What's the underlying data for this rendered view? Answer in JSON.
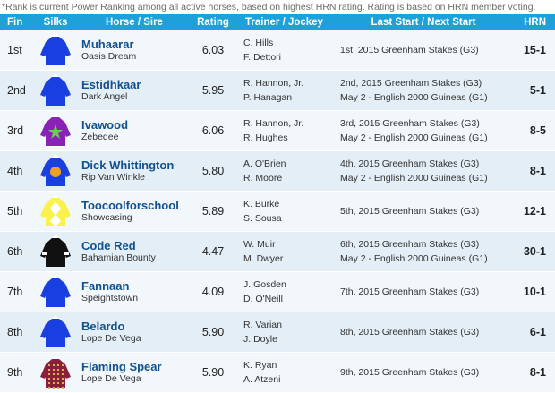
{
  "note": "*Rank is current Power Ranking among all active horses, based on highest HRN rating. Rating is based on HRN member voting.",
  "header": {
    "fin": "Fin",
    "silks": "Silks",
    "horse": "Horse / Sire",
    "rating": "Rating",
    "trainer": "Trainer / Jockey",
    "last": "Last Start / Next Start",
    "hrn": "HRN"
  },
  "rows": [
    {
      "fin": "1st",
      "horse": "Muhaarar",
      "sire": "Oasis Dream",
      "rating": "6.03",
      "trainer": "C. Hills",
      "jockey": "F. Dettori",
      "last": "1st, 2015 Greenham Stakes (G3)",
      "next": "",
      "hrn": "15-1",
      "silk": "royal-blue"
    },
    {
      "fin": "2nd",
      "horse": "Estidhkaar",
      "sire": "Dark Angel",
      "rating": "5.95",
      "trainer": "R. Hannon, Jr.",
      "jockey": "P. Hanagan",
      "last": "2nd, 2015 Greenham Stakes (G3)",
      "next": "May 2 - English 2000 Guineas (G1)",
      "hrn": "5-1",
      "silk": "royal-blue"
    },
    {
      "fin": "3rd",
      "horse": "Ivawood",
      "sire": "Zebedee",
      "rating": "6.06",
      "trainer": "R. Hannon, Jr.",
      "jockey": "R. Hughes",
      "last": "3rd, 2015 Greenham Stakes (G3)",
      "next": "May 2 - English 2000 Guineas (G1)",
      "hrn": "8-5",
      "silk": "purple-green-star"
    },
    {
      "fin": "4th",
      "horse": "Dick Whittington",
      "sire": "Rip Van Winkle",
      "rating": "5.80",
      "trainer": "A. O'Brien",
      "jockey": "R. Moore",
      "last": "4th, 2015 Greenham Stakes (G3)",
      "next": "May 2 - English 2000 Guineas (G1)",
      "hrn": "8-1",
      "silk": "blue-orange-disc"
    },
    {
      "fin": "5th",
      "horse": "Toocoolforschool",
      "sire": "Showcasing",
      "rating": "5.89",
      "trainer": "K. Burke",
      "jockey": "S. Sousa",
      "last": "5th, 2015 Greenham Stakes (G3)",
      "next": "",
      "hrn": "12-1",
      "silk": "yellow-white-diamonds"
    },
    {
      "fin": "6th",
      "horse": "Code Red",
      "sire": "Bahamian Bounty",
      "rating": "4.47",
      "trainer": "W. Muir",
      "jockey": "M. Dwyer",
      "last": "6th, 2015 Greenham Stakes (G3)",
      "next": "May 2 - English 2000 Guineas (G1)",
      "hrn": "30-1",
      "silk": "black-white"
    },
    {
      "fin": "7th",
      "horse": "Fannaan",
      "sire": "Speightstown",
      "rating": "4.09",
      "trainer": "J. Gosden",
      "jockey": "D. O'Neill",
      "last": "7th, 2015 Greenham Stakes (G3)",
      "next": "",
      "hrn": "10-1",
      "silk": "royal-blue"
    },
    {
      "fin": "8th",
      "horse": "Belardo",
      "sire": "Lope De Vega",
      "rating": "5.90",
      "trainer": "R. Varian",
      "jockey": "J. Doyle",
      "last": "8th, 2015 Greenham Stakes (G3)",
      "next": "",
      "hrn": "6-1",
      "silk": "royal-blue"
    },
    {
      "fin": "9th",
      "horse": "Flaming Spear",
      "sire": "Lope De Vega",
      "rating": "5.90",
      "trainer": "K. Ryan",
      "jockey": "A. Atzeni",
      "last": "9th, 2015 Greenham Stakes (G3)",
      "next": "",
      "hrn": "8-1",
      "silk": "maroon-gold-check"
    }
  ],
  "colors": {
    "header_bg": "#1ea0d8",
    "row_light": "#f1f7fb",
    "row_dark": "#e3eef6",
    "horse_name": "#12508e",
    "silk_blue": "#1a3fe0",
    "silk_purple": "#8a22b8",
    "silk_green": "#66d24a",
    "silk_orange": "#f0a020",
    "silk_yellow": "#f8f24a",
    "silk_black": "#111111",
    "silk_maroon": "#8a1f3a",
    "silk_gold": "#d7b25a"
  }
}
